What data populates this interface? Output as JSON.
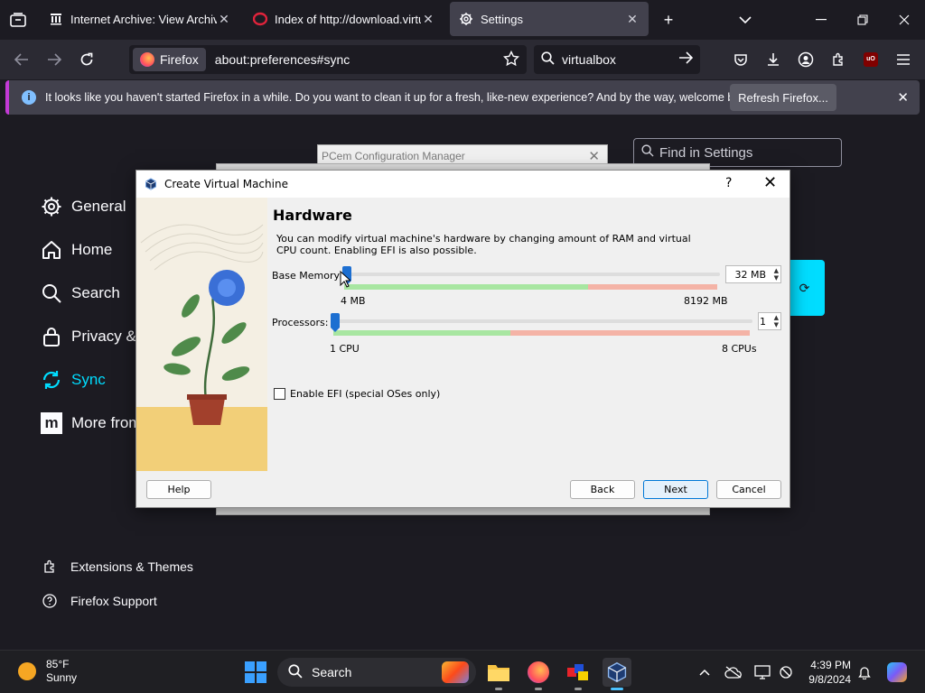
{
  "browser": {
    "tabs": [
      {
        "label": "Internet Archive: View Archive",
        "icon": "archive-icon",
        "active": false
      },
      {
        "label": "Index of http://download.virtualbox",
        "icon": "opera-icon",
        "active": false
      },
      {
        "label": "Settings",
        "icon": "gear-icon",
        "active": true
      }
    ],
    "identity_label": "Firefox",
    "url": "about:preferences#sync",
    "search_value": "virtualbox"
  },
  "notification": {
    "text": "It looks like you haven't started Firefox in a while. Do you want to clean it up for a fresh, like-new experience? And by the way, welcome back!",
    "button": "Refresh Firefox..."
  },
  "settings": {
    "find_placeholder": "Find in Settings",
    "nav": [
      {
        "label": "General",
        "icon": "gear-icon"
      },
      {
        "label": "Home",
        "icon": "home-icon"
      },
      {
        "label": "Search",
        "icon": "search-icon"
      },
      {
        "label": "Privacy &",
        "icon": "lock-icon"
      },
      {
        "label": "Sync",
        "icon": "sync-icon",
        "active": true
      },
      {
        "label": "More from",
        "icon": "mozilla-icon"
      }
    ],
    "footer_links": [
      {
        "label": "Extensions & Themes",
        "icon": "puzzle-icon"
      },
      {
        "label": "Firefox Support",
        "icon": "help-icon"
      }
    ]
  },
  "background_windows": {
    "pcem_title": "PCem Configuration Manager"
  },
  "dialog": {
    "title": "Create Virtual Machine",
    "help_glyph": "?",
    "heading": "Hardware",
    "description": "You can modify virtual machine's hardware by changing amount of RAM and virtual CPU count. Enabling EFI is also possible.",
    "memory": {
      "label": "Base Memory:",
      "value": "32 MB",
      "min_label": "4 MB",
      "max_label": "8192 MB",
      "min": 4,
      "max": 8192,
      "current": 32
    },
    "processors": {
      "label": "Processors:",
      "value": "1",
      "min_label": "1 CPU",
      "max_label": "8 CPUs",
      "min": 1,
      "max": 8,
      "current": 1
    },
    "efi_label": "Enable EFI (special OSes only)",
    "efi_checked": false,
    "buttons": {
      "help": "Help",
      "back": "Back",
      "next": "Next",
      "cancel": "Cancel"
    }
  },
  "taskbar": {
    "weather_temp": "85°F",
    "weather_condition": "Sunny",
    "search_label": "Search",
    "time": "4:39 PM",
    "date": "9/8/2024"
  },
  "colors": {
    "accent_sync": "#00ddff",
    "notification_bar": "#c33ad6",
    "slider_handle": "#1d6fd1",
    "slider_green": "#a8e6a1",
    "slider_red": "#f4b3a6"
  }
}
